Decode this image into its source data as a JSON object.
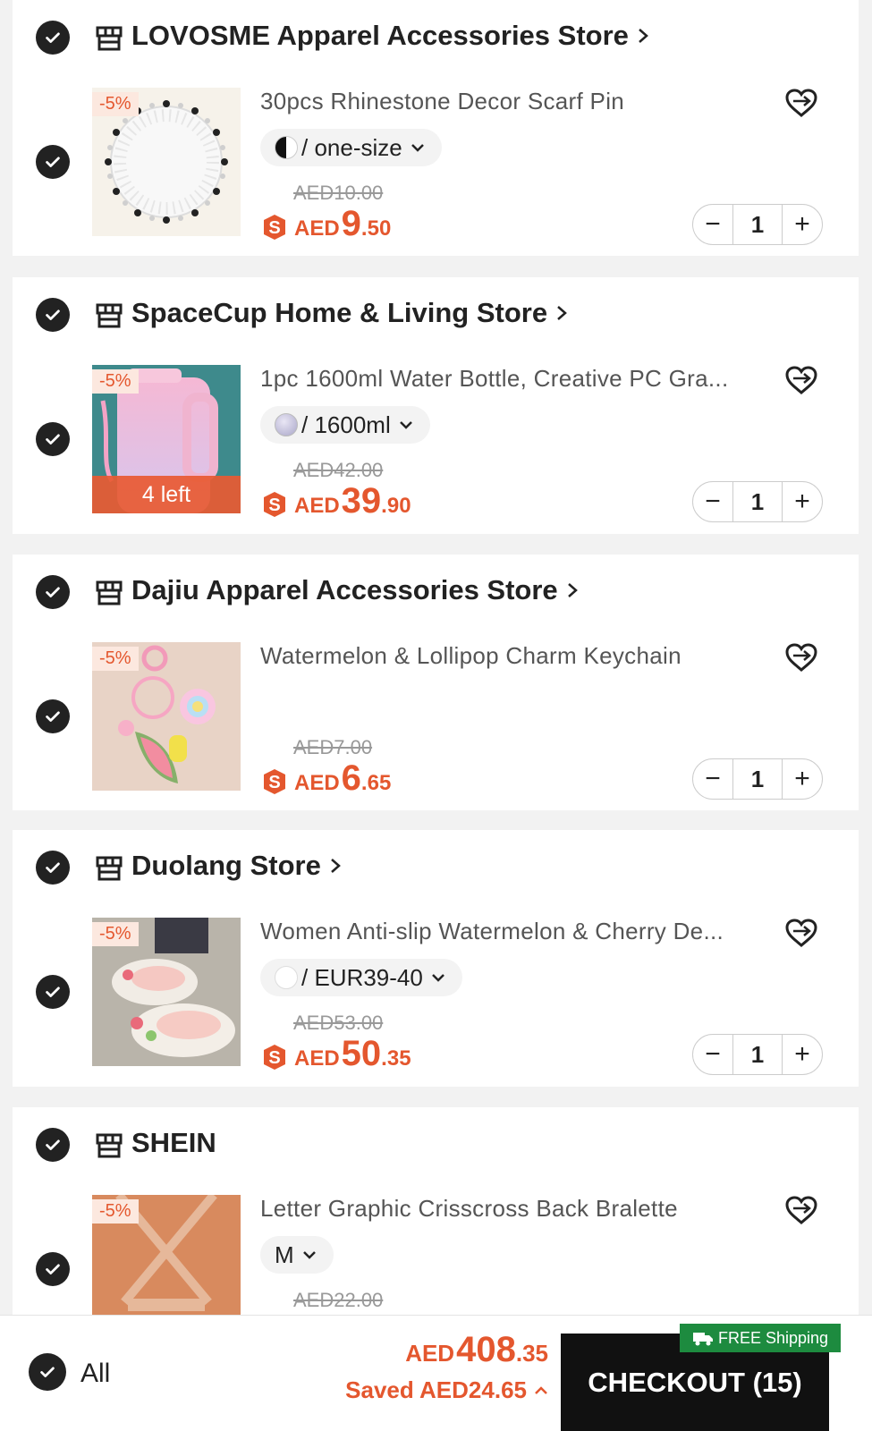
{
  "icons": {
    "select": "checkmark-circle-icon",
    "store": "storefront-icon",
    "wishlist": "heart-add-icon",
    "coin": "s-coin-icon",
    "shipping": "truck-icon"
  },
  "colors": {
    "accent": "#e4572e",
    "dark": "#111111",
    "shipping_green": "#1d8b3f"
  },
  "stores": [
    {
      "name": "LOVOSME Apparel Accessories Store",
      "item": {
        "title": "30pcs Rhinestone Decor Scarf Pin",
        "discount": "-5%",
        "variant": "/ one-size",
        "original_price": "AED10.00",
        "currency": "AED",
        "price_int": "9",
        "price_dec": ".50",
        "quantity": "1"
      }
    },
    {
      "name": "SpaceCup Home & Living Store",
      "item": {
        "title": "1pc 1600ml Water Bottle, Creative PC Gra...",
        "discount": "-5%",
        "stock": "4 left",
        "variant": "/ 1600ml",
        "original_price": "AED42.00",
        "currency": "AED",
        "price_int": "39",
        "price_dec": ".90",
        "quantity": "1"
      }
    },
    {
      "name": "Dajiu Apparel Accessories Store",
      "item": {
        "title": "Watermelon & Lollipop Charm Keychain",
        "discount": "-5%",
        "original_price": "AED7.00",
        "currency": "AED",
        "price_int": "6",
        "price_dec": ".65",
        "quantity": "1"
      }
    },
    {
      "name": "Duolang Store",
      "item": {
        "title": "Women Anti-slip Watermelon & Cherry De...",
        "discount": "-5%",
        "variant": "/ EUR39-40",
        "original_price": "AED53.00",
        "currency": "AED",
        "price_int": "50",
        "price_dec": ".35",
        "quantity": "1"
      }
    },
    {
      "name": "SHEIN",
      "item": {
        "title": "Letter Graphic Crisscross Back Bralette",
        "discount": "-5%",
        "variant": "M",
        "original_price": "AED22.00"
      }
    }
  ],
  "bottom": {
    "all_label": "All",
    "total_currency": "AED",
    "total_int": "408",
    "total_dec": ".35",
    "saved": "Saved AED24.65",
    "free_shipping": "FREE Shipping",
    "checkout": "CHECKOUT (15)"
  }
}
